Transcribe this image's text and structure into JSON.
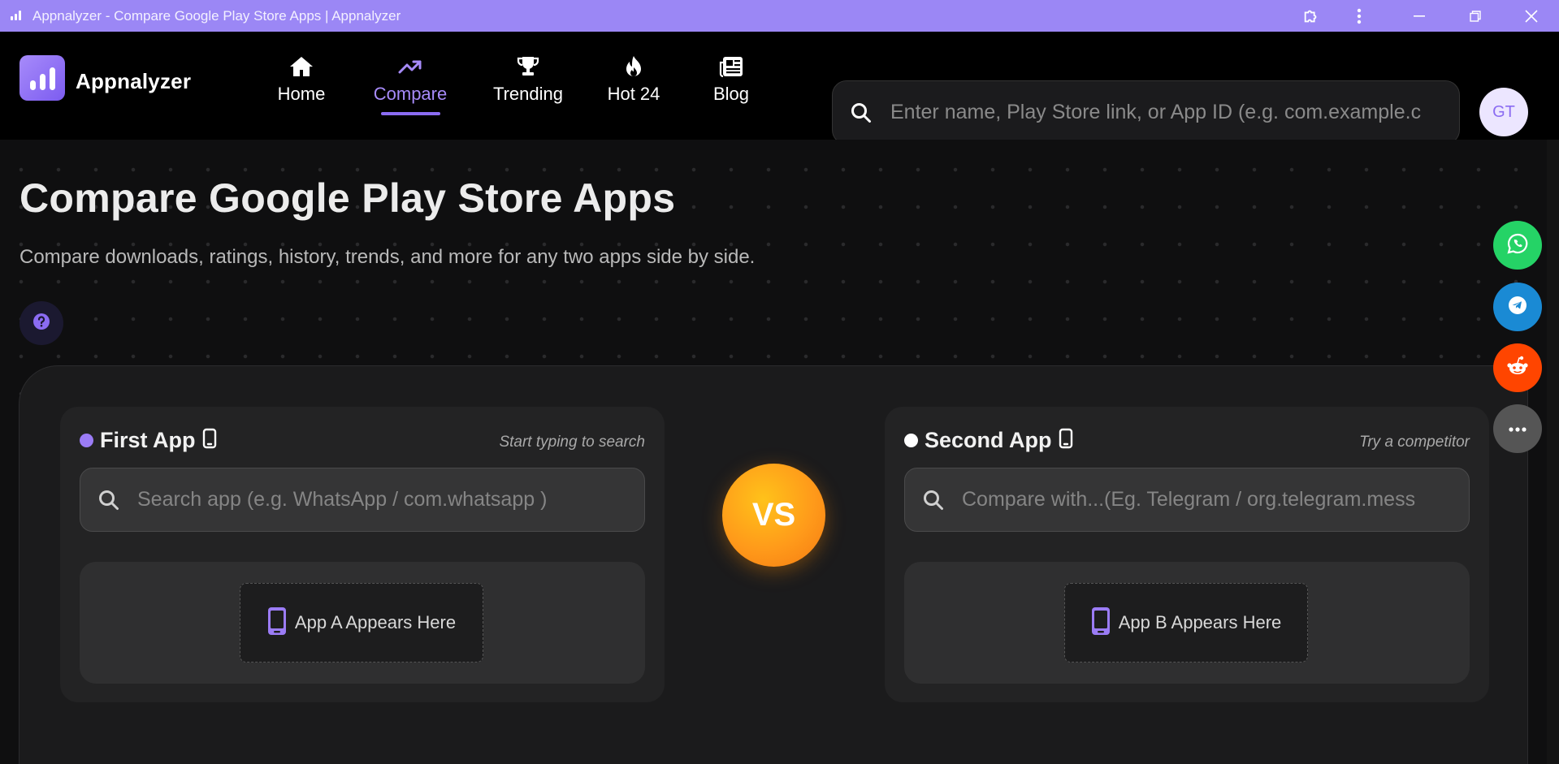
{
  "window": {
    "title": "Appnalyzer - Compare Google Play Store Apps | Appnalyzer"
  },
  "header": {
    "brand": "Appnalyzer",
    "nav": [
      {
        "label": "Home",
        "icon": "home-icon"
      },
      {
        "label": "Compare",
        "icon": "trending-up-icon",
        "active": true
      },
      {
        "label": "Trending",
        "icon": "trophy-icon"
      },
      {
        "label": "Hot 24",
        "icon": "flame-icon"
      },
      {
        "label": "Blog",
        "icon": "newspaper-icon"
      }
    ],
    "search_placeholder": "Enter name, Play Store link, or App ID (e.g. com.example.c",
    "avatar_initials": "GT"
  },
  "page": {
    "title": "Compare Google Play Store Apps",
    "subtitle": "Compare downloads, ratings, history, trends, and more for any two apps side by side."
  },
  "compare": {
    "first": {
      "title": "First App",
      "hint": "Start typing to search",
      "placeholder": "Search app (e.g. WhatsApp / com.whatsapp )",
      "slot_label": "App A Appears Here",
      "dot_color": "#9b7cf6"
    },
    "second": {
      "title": "Second App",
      "hint": "Try a competitor",
      "placeholder": "Compare with...(Eg. Telegram / org.telegram.mess",
      "slot_label": "App B Appears Here",
      "dot_color": "#ffffff"
    },
    "vs_label": "VS"
  },
  "share": [
    {
      "name": "whatsapp",
      "color": "#25d366"
    },
    {
      "name": "telegram",
      "color": "#1a8ad4"
    },
    {
      "name": "reddit",
      "color": "#ff4500"
    },
    {
      "name": "more",
      "color": "#555555"
    }
  ],
  "colors": {
    "accent": "#8b6cf2",
    "titlebar": "#9b87f5"
  }
}
